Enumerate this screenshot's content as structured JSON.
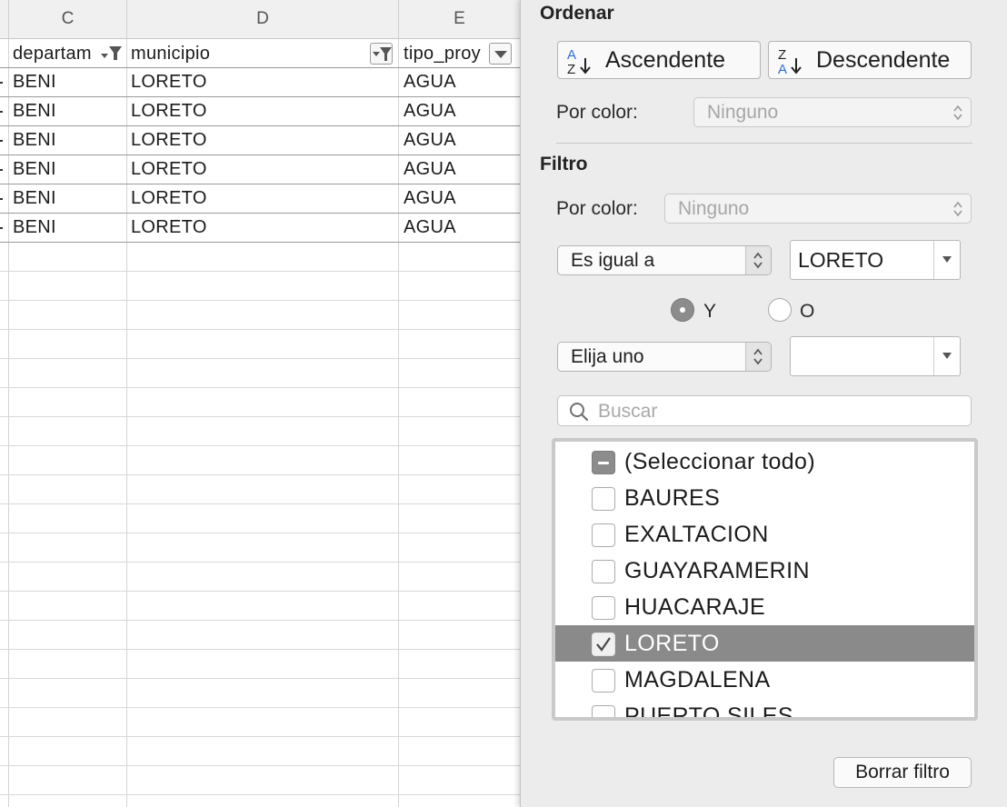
{
  "sheet": {
    "columns": [
      "C",
      "D",
      "E"
    ],
    "headers": {
      "c": "departam",
      "d": "municipio",
      "e": "tipo_proy"
    },
    "rows": [
      {
        "c": "BENI",
        "d": "LORETO",
        "e": "AGUA"
      },
      {
        "c": "BENI",
        "d": "LORETO",
        "e": "AGUA"
      },
      {
        "c": "BENI",
        "d": "LORETO",
        "e": "AGUA"
      },
      {
        "c": "BENI",
        "d": "LORETO",
        "e": "AGUA"
      },
      {
        "c": "BENI",
        "d": "LORETO",
        "e": "AGUA"
      },
      {
        "c": "BENI",
        "d": "LORETO",
        "e": "AGUA"
      }
    ],
    "filter_icons": {
      "c": "filter-active-icon",
      "d": "filter-active-icon",
      "e": "dropdown-arrow-icon"
    }
  },
  "panel": {
    "sort_title": "Ordenar",
    "asc_label": "Ascendente",
    "desc_label": "Descendente",
    "asc_icon": "sort-az-icon",
    "desc_icon": "sort-za-icon",
    "sort_by_color_label": "Por color:",
    "sort_by_color_value": "Ninguno",
    "filter_title": "Filtro",
    "filter_by_color_label": "Por color:",
    "filter_by_color_value": "Ninguno",
    "condition1": {
      "operator": "Es igual a",
      "value": "LORETO"
    },
    "logic": {
      "and_label": "Y",
      "or_label": "O",
      "selected": "Y"
    },
    "condition2": {
      "operator": "Elija uno",
      "value": ""
    },
    "search_placeholder": "Buscar",
    "list_items": [
      {
        "label": "(Seleccionar todo)",
        "state": "mixed"
      },
      {
        "label": "BAURES",
        "state": "unchecked"
      },
      {
        "label": "EXALTACION",
        "state": "unchecked"
      },
      {
        "label": "GUAYARAMERIN",
        "state": "unchecked"
      },
      {
        "label": "HUACARAJE",
        "state": "unchecked"
      },
      {
        "label": "LORETO",
        "state": "checked"
      },
      {
        "label": "MAGDALENA",
        "state": "unchecked"
      },
      {
        "label": "PUERTO SILES",
        "state": "unchecked"
      }
    ],
    "clear_label": "Borrar filtro"
  },
  "colors": {
    "selected_row": "#8a8a8a",
    "panel_bg": "#ececec",
    "radio_on": "#8c8c8c"
  }
}
